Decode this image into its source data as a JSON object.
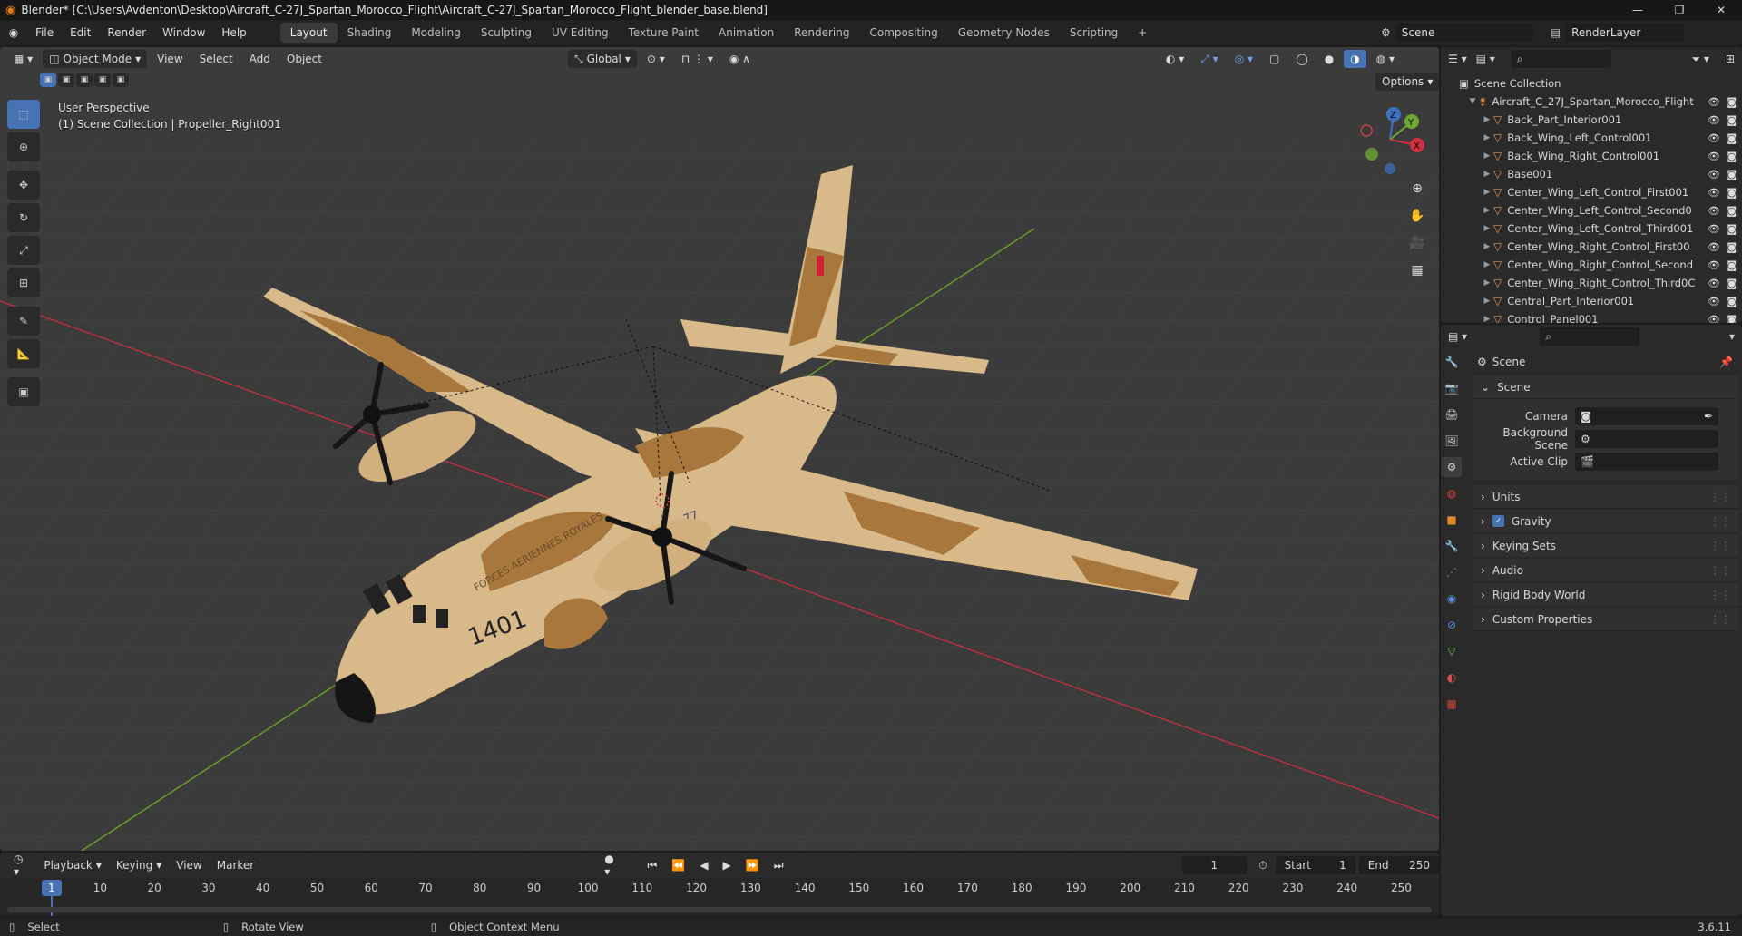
{
  "window": {
    "title": "Blender* [C:\\Users\\Avdenton\\Desktop\\Aircraft_C-27J_Spartan_Morocco_Flight\\Aircraft_C-27J_Spartan_Morocco_Flight_blender_base.blend]",
    "minimize": "—",
    "maximize": "❐",
    "close": "✕"
  },
  "menubar": {
    "items": [
      "File",
      "Edit",
      "Render",
      "Window",
      "Help"
    ],
    "workspaces": [
      "Layout",
      "Shading",
      "Modeling",
      "Sculpting",
      "UV Editing",
      "Texture Paint",
      "Animation",
      "Rendering",
      "Compositing",
      "Geometry Nodes",
      "Scripting"
    ],
    "active_workspace": "Layout",
    "add_tab": "+",
    "scene": "Scene",
    "view_layer": "RenderLayer"
  },
  "viewport": {
    "mode": "Object Mode",
    "menus": [
      "View",
      "Select",
      "Add",
      "Object"
    ],
    "orientation": "Global",
    "options": "Options",
    "perspective": "User Perspective",
    "context": "(1) Scene Collection | Propeller_Right001",
    "gizmo": {
      "z": "Z",
      "y": "Y",
      "x": "X"
    },
    "colors": {
      "bg": "#3b3b3b",
      "grid": "#474747",
      "x_axis": "#b3313f",
      "y_axis": "#6a9a2a",
      "sand": "#d8b98a",
      "camo": "#a8773c"
    },
    "aircraft": {
      "tail_number": "1401",
      "nose_text": "FORCES AERIENNES ROYALES",
      "fin_code": "77"
    }
  },
  "outliner": {
    "search_placeholder": "",
    "root": "Scene Collection",
    "collection": "Aircraft_C_27J_Spartan_Morocco_Flight",
    "items": [
      "Back_Part_Interior001",
      "Back_Wing_Left_Control001",
      "Back_Wing_Right_Control001",
      "Base001",
      "Center_Wing_Left_Control_First001",
      "Center_Wing_Left_Control_Second0",
      "Center_Wing_Left_Control_Third001",
      "Center_Wing_Right_Control_First00",
      "Center_Wing_Right_Control_Second",
      "Center_Wing_Right_Control_Third0C",
      "Central_Part_Interior001",
      "Control_Panel001"
    ]
  },
  "properties": {
    "header": "Scene",
    "section": "Scene",
    "fields": [
      {
        "label": "Camera",
        "value": ""
      },
      {
        "label": "Background Scene",
        "value": ""
      },
      {
        "label": "Active Clip",
        "value": ""
      }
    ],
    "panels": [
      "Units",
      "Gravity",
      "Keying Sets",
      "Audio",
      "Rigid Body World",
      "Custom Properties"
    ],
    "gravity_checked": true
  },
  "timeline": {
    "menus": [
      "Playback",
      "Keying",
      "View",
      "Marker"
    ],
    "current_frame": "1",
    "start_label": "Start",
    "start": "1",
    "end_label": "End",
    "end": "250",
    "ticks": [
      "1",
      "10",
      "20",
      "30",
      "40",
      "50",
      "60",
      "70",
      "80",
      "90",
      "100",
      "110",
      "120",
      "130",
      "140",
      "150",
      "160",
      "170",
      "180",
      "190",
      "200",
      "210",
      "220",
      "230",
      "240",
      "250"
    ]
  },
  "statusbar": {
    "select": "Select",
    "rotate": "Rotate View",
    "context_menu": "Object Context Menu",
    "version": "3.6.11"
  }
}
